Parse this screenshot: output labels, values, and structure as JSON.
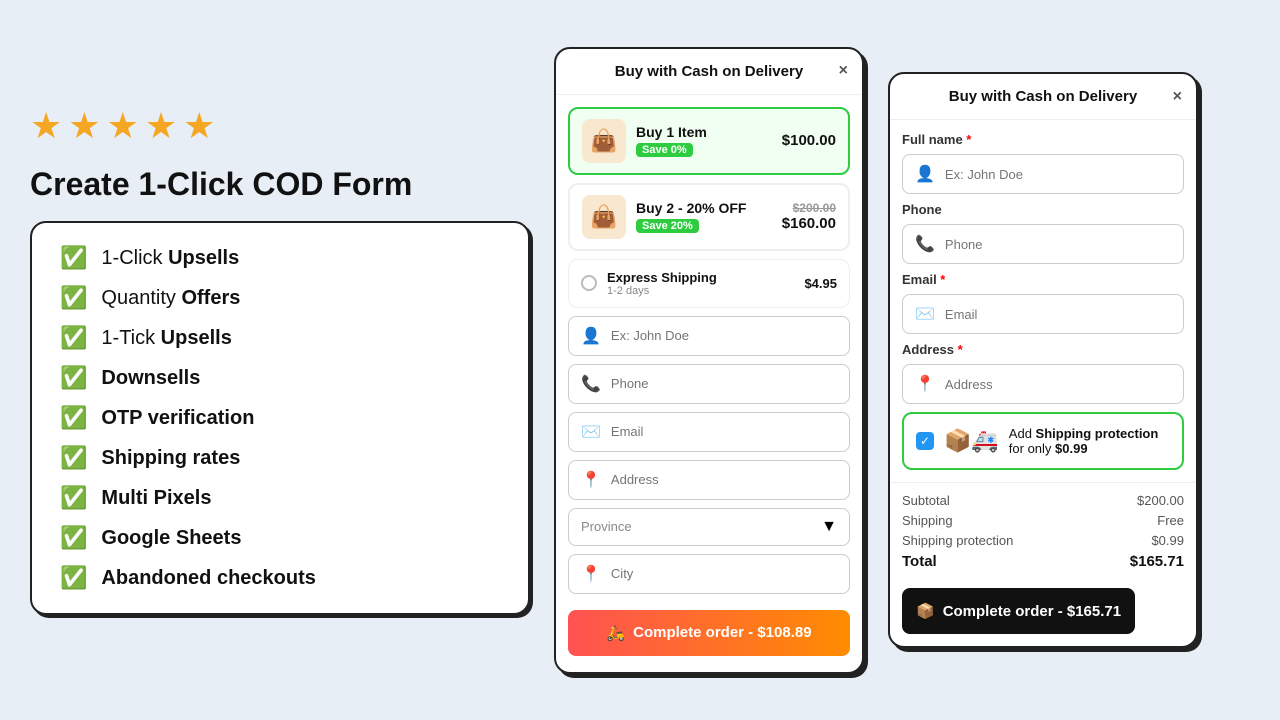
{
  "left": {
    "stars": [
      "★",
      "★",
      "★",
      "★",
      "★"
    ],
    "title": "Create 1-Click COD Form",
    "features": [
      {
        "label": "1-Click ",
        "bold": "Upsells"
      },
      {
        "label": "Quantity ",
        "bold": "Offers"
      },
      {
        "label": "1-Tick ",
        "bold": "Upsells"
      },
      {
        "label": "",
        "bold": "Downsells"
      },
      {
        "label": "",
        "bold": "OTP verification"
      },
      {
        "label": "",
        "bold": "Shipping rates"
      },
      {
        "label": "",
        "bold": "Multi Pixels"
      },
      {
        "label": "",
        "bold": "Google Sheets"
      },
      {
        "label": "",
        "bold": "Abandoned checkouts"
      }
    ]
  },
  "modal1": {
    "title": "Buy with Cash on Delivery",
    "close": "×",
    "qty_options": [
      {
        "selected": true,
        "img": "👜",
        "title": "Buy 1 Item",
        "badge": "Save 0%",
        "price": "$100.00",
        "old_price": null
      },
      {
        "selected": false,
        "img": "👜",
        "title": "Buy 2 - 20% OFF",
        "badge": "Save 20%",
        "price": "$160.00",
        "old_price": "$200.00"
      }
    ],
    "shipping": {
      "title": "Express Shipping",
      "sub": "1-2 days",
      "price": "$4.95"
    },
    "fields": [
      {
        "icon": "👤",
        "placeholder": "Ex: John Doe"
      },
      {
        "icon": "📞",
        "placeholder": "Phone"
      },
      {
        "icon": "✉️",
        "placeholder": "Email"
      },
      {
        "icon": "📍",
        "placeholder": "Address"
      }
    ],
    "province_placeholder": "Province",
    "city_placeholder": "City",
    "complete_btn": "Complete order - $108.89"
  },
  "modal2": {
    "title": "Buy with Cash on Delivery",
    "close": "×",
    "fields": [
      {
        "label": "Full name",
        "required": true,
        "icon": "👤",
        "placeholder": "Ex: John Doe"
      },
      {
        "label": "Phone",
        "required": false,
        "icon": "📞",
        "placeholder": "Phone"
      },
      {
        "label": "Email",
        "required": true,
        "icon": "✉️",
        "placeholder": "Email"
      },
      {
        "label": "Address",
        "required": true,
        "icon": "📍",
        "placeholder": "Address"
      }
    ],
    "protection": {
      "icons": "📦🚑",
      "text_pre": "Add ",
      "text_bold": "Shipping protection",
      "text_post": " for only ",
      "price": "$0.99"
    },
    "summary": {
      "subtotal_label": "Subtotal",
      "subtotal_value": "$200.00",
      "shipping_label": "Shipping",
      "shipping_value": "Free",
      "protection_label": "Shipping protection",
      "protection_value": "$0.99",
      "total_label": "Total",
      "total_value": "$165.71"
    },
    "complete_btn": "Complete order - $165.71"
  }
}
